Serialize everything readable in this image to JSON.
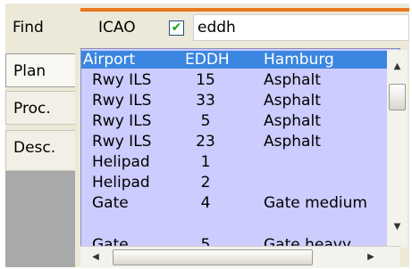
{
  "tabs": {
    "find": "Find",
    "plan": "Plan",
    "proc": "Proc.",
    "desc": "Desc."
  },
  "toolbar": {
    "icao_label": "ICAO",
    "icao_checked": true,
    "search_value": "eddh"
  },
  "list": {
    "header": {
      "type": "Airport",
      "code": "EDDH",
      "name": "Hamburg"
    },
    "rows": [
      {
        "type": "Rwy ILS",
        "id": "15",
        "detail": "Asphalt"
      },
      {
        "type": "Rwy ILS",
        "id": "33",
        "detail": "Asphalt"
      },
      {
        "type": "Rwy ILS",
        "id": "5",
        "detail": "Asphalt"
      },
      {
        "type": "Rwy ILS",
        "id": "23",
        "detail": "Asphalt"
      },
      {
        "type": "Helipad",
        "id": "1",
        "detail": ""
      },
      {
        "type": "Helipad",
        "id": "2",
        "detail": ""
      },
      {
        "type": "Gate",
        "id": "4",
        "detail": "Gate medium"
      },
      {
        "type": "Gate",
        "id": "5",
        "detail": "Gate heavy"
      }
    ]
  },
  "colors": {
    "accent_line": "#e8781e",
    "selection": "#3a86e0",
    "list_bg": "#ccccff"
  }
}
